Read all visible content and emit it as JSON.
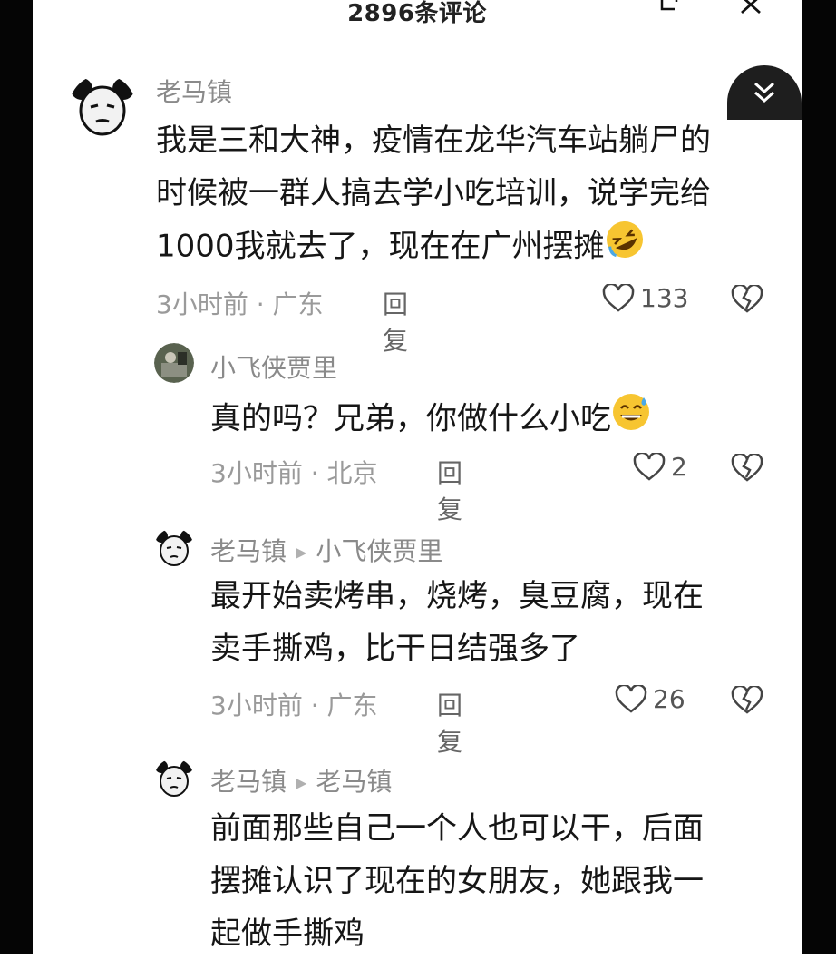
{
  "header": {
    "title": "2896条评论"
  },
  "comments": [
    {
      "user": "老马镇",
      "text_lines": [
        "我是三和大神，疫情在龙华汽车站躺尸的",
        "时候被一群人搞去学小吃培训，说学完给",
        "1000我就去了，现在在广州摆摊"
      ],
      "time_loc": "3小时前 · 广东",
      "reply_label": "回复",
      "likes": "133",
      "emoji": "rolling-laughing-emoji"
    },
    {
      "user": "小飞侠贾里",
      "text_lines": [
        "真的吗？兄弟，你做什么小吃"
      ],
      "time_loc": "3小时前 · 北京",
      "reply_label": "回复",
      "likes": "2",
      "emoji": "sweat-smile-emoji"
    },
    {
      "user": "老马镇",
      "reply_to": "小飞侠贾里",
      "text_lines": [
        "最开始卖烤串，烧烤，臭豆腐，现在",
        "卖手撕鸡，比干日结强多了"
      ],
      "time_loc": "3小时前 · 广东",
      "reply_label": "回复",
      "likes": "26"
    },
    {
      "user": "老马镇",
      "reply_to": "老马镇",
      "text_lines": [
        "前面那些自己一个人也可以干，后面",
        "摆摊认识了现在的女朋友，她跟我一",
        "起做手撕鸡"
      ]
    }
  ]
}
